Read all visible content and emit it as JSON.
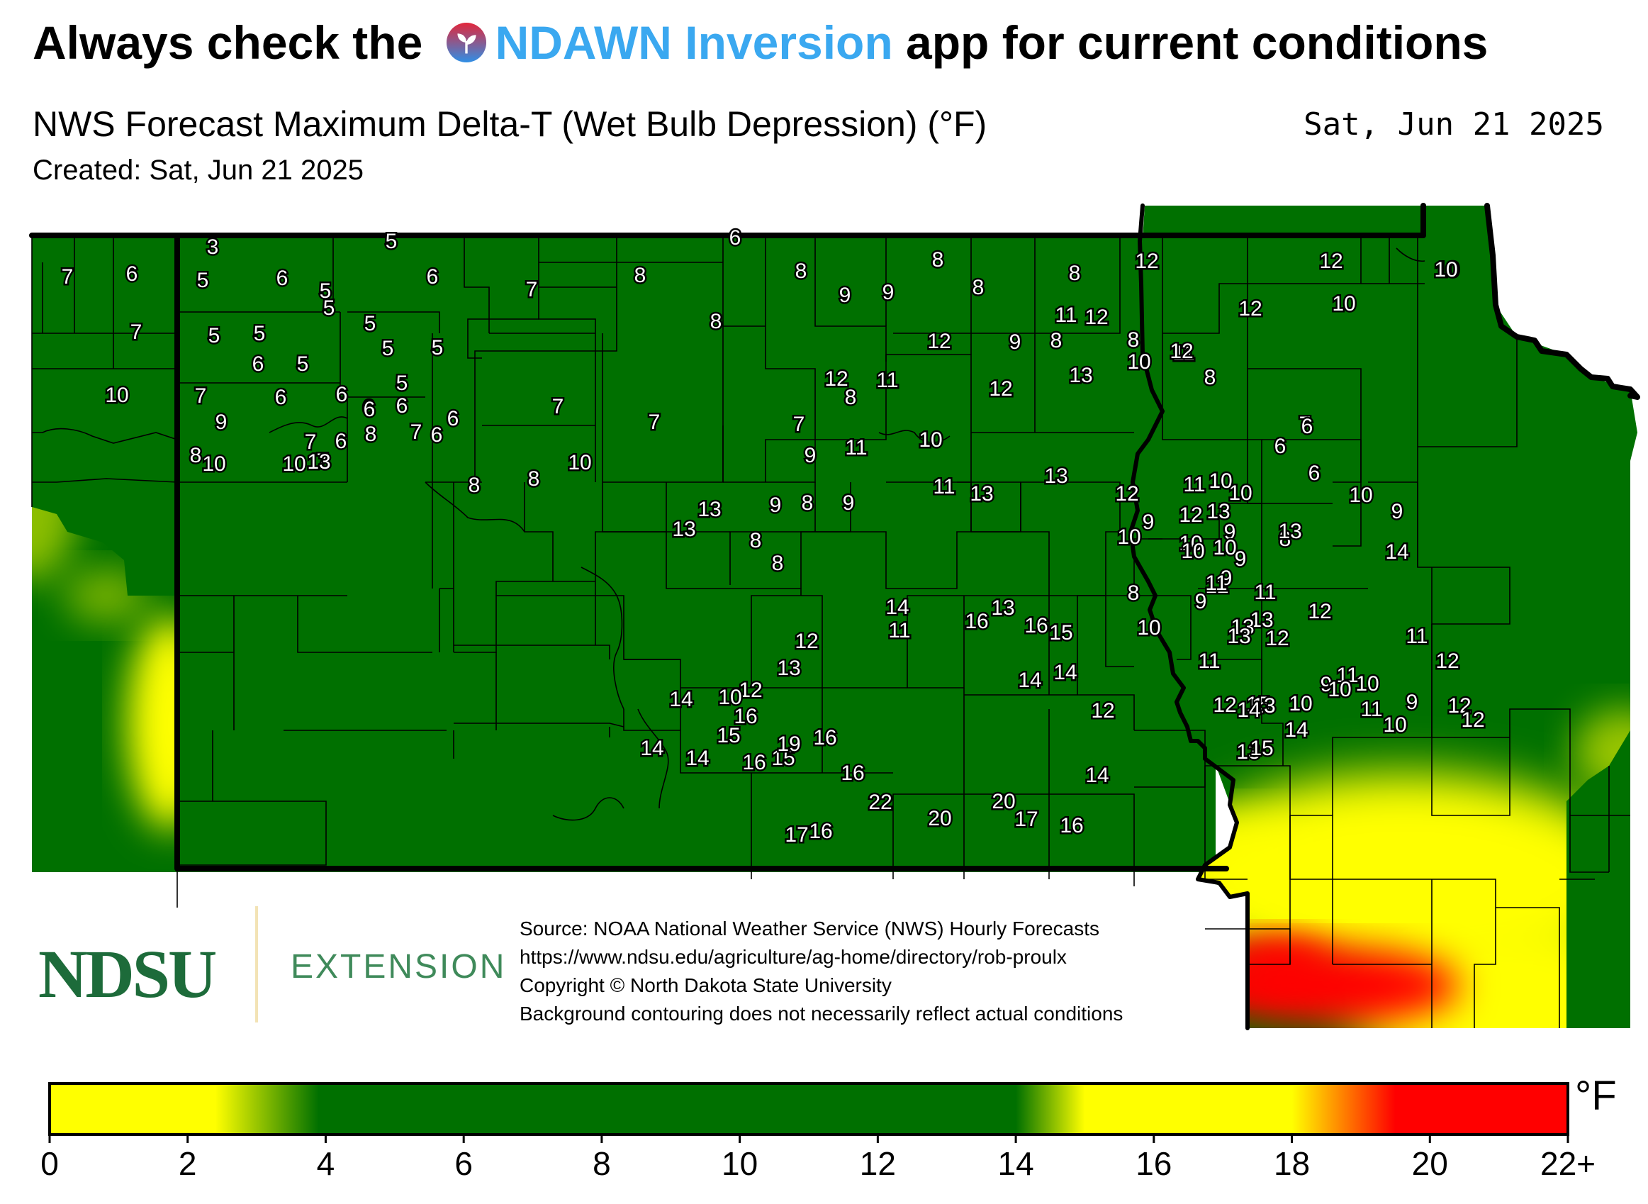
{
  "header": {
    "headline_prefix": "Always check the ",
    "app_name": "NDAWN Inversion",
    "headline_suffix": " app for current conditions",
    "subtitle": "NWS Forecast Maximum Delta-T (Wet Bulb Depression) (°F)",
    "valid_date": "Sat, Jun 21 2025",
    "created": "Created: Sat, Jun 21 2025"
  },
  "colors": {
    "low_yellow": "#ffff00",
    "good_green": "#007000",
    "high_yellow": "#ffff00",
    "red": "#ff0000",
    "boundary": "#000000",
    "app_name": "#3aa8f0"
  },
  "map": {
    "station_values": [
      "3",
      "5",
      "6",
      "7",
      "6",
      "5",
      "6",
      "5",
      "6",
      "7",
      "8",
      "8",
      "9",
      "9",
      "8",
      "8",
      "12",
      "12",
      "10",
      "7",
      "5",
      "5",
      "5",
      "5",
      "5",
      "5",
      "6",
      "5",
      "8",
      "8",
      "11",
      "12",
      "11",
      "10",
      "10",
      "7",
      "6",
      "6",
      "6",
      "5",
      "6",
      "7",
      "7",
      "7",
      "8",
      "9",
      "8",
      "10",
      "12",
      "12",
      "10",
      "9",
      "7",
      "6",
      "6",
      "6",
      "8",
      "7",
      "6",
      "7",
      "8",
      "10",
      "10",
      "13",
      "12",
      "11",
      "12",
      "11",
      "12",
      "13",
      "8",
      "8",
      "7",
      "6",
      "6",
      "6",
      "8",
      "8",
      "10",
      "13",
      "13",
      "9",
      "9",
      "8",
      "8",
      "9",
      "8",
      "10",
      "11",
      "13",
      "13",
      "12",
      "11",
      "12",
      "13",
      "10",
      "9",
      "10",
      "9",
      "8",
      "10",
      "9",
      "10",
      "11",
      "13",
      "14",
      "12",
      "9",
      "9",
      "8",
      "10",
      "10",
      "10",
      "10",
      "9",
      "11",
      "13",
      "13",
      "13",
      "12",
      "15",
      "12",
      "12",
      "11",
      "10",
      "9",
      "9",
      "10",
      "11",
      "10",
      "13",
      "12",
      "14",
      "14",
      "13",
      "15",
      "12",
      "12",
      "11",
      "10",
      "11",
      "12",
      "14",
      "14",
      "15",
      "16",
      "13",
      "16",
      "14",
      "11",
      "12",
      "13",
      "12",
      "10",
      "14",
      "16",
      "15",
      "14",
      "14",
      "16",
      "15",
      "16",
      "19",
      "16",
      "17",
      "16",
      "22",
      "20",
      "20",
      "17",
      "16",
      "14"
    ]
  },
  "credits": {
    "logo": "NDSU",
    "unit": "EXTENSION",
    "source_lines": [
      "Source: NOAA National Weather Service (NWS) Hourly Forecasts",
      "https://www.ndsu.edu/agriculture/ag-home/directory/rob-proulx",
      "Copyright © North Dakota State University",
      "Background contouring does not necessarily reflect actual conditions"
    ]
  },
  "legend": {
    "unit": "°F",
    "ticks": [
      "0",
      "2",
      "4",
      "6",
      "8",
      "10",
      "12",
      "14",
      "16",
      "18",
      "20",
      "22+"
    ],
    "stops": [
      {
        "value": 0,
        "color": "#ffff00"
      },
      {
        "value": 2.4,
        "color": "#ffff00"
      },
      {
        "value": 3.9,
        "color": "#007000"
      },
      {
        "value": 14.0,
        "color": "#007000"
      },
      {
        "value": 15.0,
        "color": "#ffff00"
      },
      {
        "value": 18.0,
        "color": "#ffff00"
      },
      {
        "value": 19.5,
        "color": "#ff0000"
      },
      {
        "value": 22,
        "color": "#ff0000"
      }
    ]
  }
}
